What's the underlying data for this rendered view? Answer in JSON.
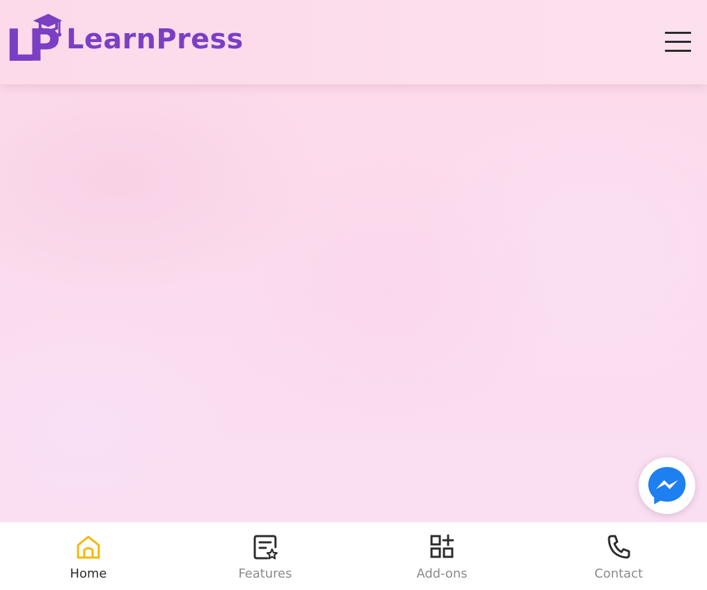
{
  "header": {
    "brand": "LearnPress",
    "logo_mark": "LP",
    "logo_color": "#7b3fc4",
    "menu_icon": "hamburger-icon"
  },
  "floating": {
    "messenger_icon": "messenger-icon",
    "messenger_color": "#1e7ff0"
  },
  "bottom_nav": {
    "active": "Home",
    "active_color": "#f5b800",
    "items": [
      {
        "label": "Home",
        "icon": "home-icon"
      },
      {
        "label": "Features",
        "icon": "features-icon"
      },
      {
        "label": "Add-ons",
        "icon": "add-ons-icon"
      },
      {
        "label": "Contact",
        "icon": "phone-icon"
      }
    ]
  }
}
